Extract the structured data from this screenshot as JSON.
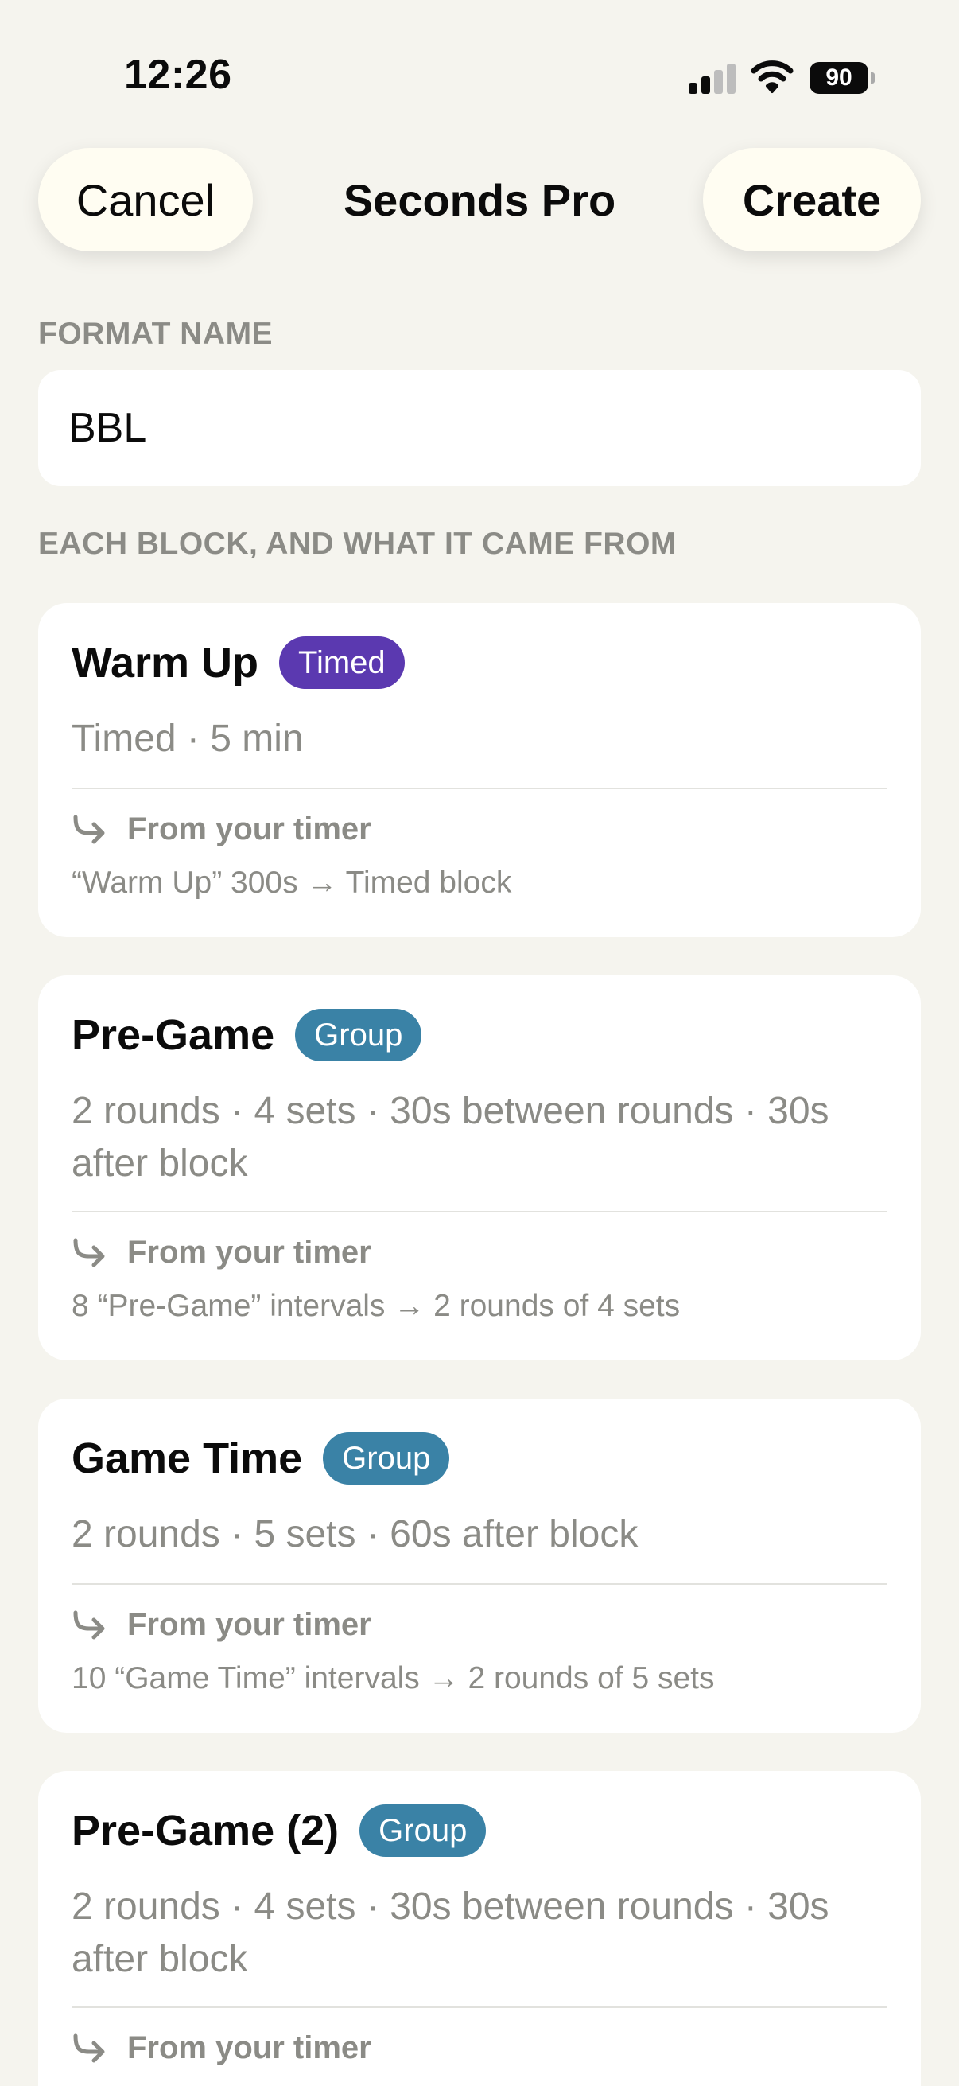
{
  "status_bar": {
    "time": "12:26",
    "battery": "90",
    "icons": [
      "cellular-signal-icon",
      "wifi-icon",
      "battery-icon"
    ]
  },
  "nav": {
    "cancel_label": "Cancel",
    "title": "Seconds Pro",
    "create_label": "Create"
  },
  "format_name": {
    "header": "FORMAT NAME",
    "value": "BBL"
  },
  "blocks_section": {
    "header": "EACH BLOCK, AND WHAT IT CAME FROM"
  },
  "blocks": [
    {
      "title": "Warm Up",
      "badge": "Timed",
      "badge_color": "#5B39B0",
      "summary": "Timed · 5 min",
      "source_label": "From your timer",
      "source_detail": "“Warm Up” 300s → Timed block"
    },
    {
      "title": "Pre-Game",
      "badge": "Group",
      "badge_color": "#3A82A6",
      "summary": "2 rounds · 4 sets · 30s between rounds · 30s after block",
      "source_label": "From your timer",
      "source_detail": "8 “Pre-Game” intervals → 2 rounds of 4 sets"
    },
    {
      "title": "Game Time",
      "badge": "Group",
      "badge_color": "#3A82A6",
      "summary": "2 rounds · 5 sets · 60s after block",
      "source_label": "From your timer",
      "source_detail": "10 “Game Time” intervals → 2 rounds of 5 sets"
    },
    {
      "title": "Pre-Game (2)",
      "badge": "Group",
      "badge_color": "#3A82A6",
      "summary": "2 rounds · 4 sets · 30s between rounds · 30s after block",
      "source_label": "From your timer"
    }
  ],
  "colors": {
    "background": "#F5F4EE",
    "card": "#FFFFFF",
    "pill": "#FFFDF2",
    "secondary_text": "#8B8B86",
    "timed_badge": "#5B39B0",
    "group_badge": "#3A82A6"
  }
}
